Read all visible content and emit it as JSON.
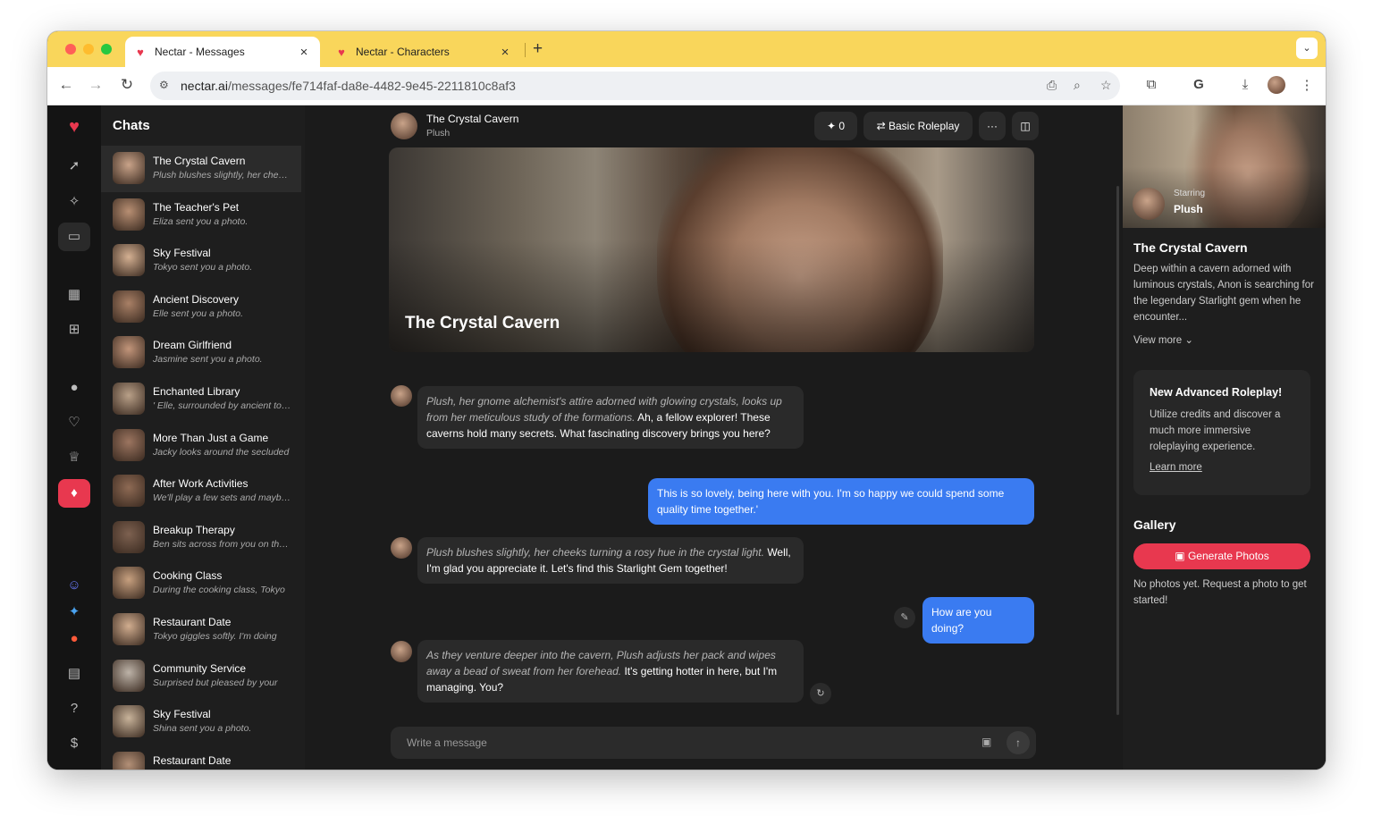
{
  "browser": {
    "tabs": [
      {
        "title": "Nectar - Messages",
        "active": true
      },
      {
        "title": "Nectar - Characters",
        "active": false
      }
    ],
    "url_host": "nectar.ai",
    "url_path": "/messages/fe714faf-da8e-4482-9e45-2211810c8af3"
  },
  "colors": {
    "accent": "#e8384f",
    "user_bubble": "#3a7bf1",
    "tabbar": "#f9d65b"
  },
  "chats": {
    "heading": "Chats",
    "items": [
      {
        "name": "The Crystal Cavern",
        "preview": "Plush blushes slightly, her cheeks turning a rosy hue",
        "active": true
      },
      {
        "name": "The Teacher's Pet",
        "preview": "Eliza sent you a photo."
      },
      {
        "name": "Sky Festival",
        "preview": "Tokyo sent you a photo."
      },
      {
        "name": "Ancient Discovery",
        "preview": "Elle sent you a photo."
      },
      {
        "name": "Dream Girlfriend",
        "preview": "Jasmine sent you a photo."
      },
      {
        "name": "Enchanted Library",
        "preview": "' Elle, surrounded by ancient tomes"
      },
      {
        "name": "More Than Just a Game",
        "preview": "Jacky looks around the secluded"
      },
      {
        "name": "After Work Activities",
        "preview": "We'll play a few sets and maybe grab"
      },
      {
        "name": "Breakup Therapy",
        "preview": "Ben sits across from you on the couch"
      },
      {
        "name": "Cooking Class",
        "preview": "During the cooking class, Tokyo"
      },
      {
        "name": "Restaurant Date",
        "preview": "Tokyo giggles softly. I'm doing"
      },
      {
        "name": "Community Service",
        "preview": "Surprised but pleased by your"
      },
      {
        "name": "Sky Festival",
        "preview": "Shina sent you a photo."
      },
      {
        "name": "Restaurant Date",
        "preview": ""
      }
    ]
  },
  "conversation": {
    "title": "The Crystal Cavern",
    "character": "Plush",
    "count": "0",
    "mode": "Basic Roleplay",
    "hero_title": "The Crystal Cavern",
    "messages": [
      {
        "from": "bot",
        "action": "Plush, her gnome alchemist's attire adorned with glowing crystals, looks up from her meticulous study of the formations.",
        "text": " Ah, a fellow explorer! These caverns hold many secrets. What fascinating discovery brings you here?"
      },
      {
        "from": "user",
        "text": "This is so lovely, being here with you. I'm so happy we could spend some quality time together.'"
      },
      {
        "from": "bot",
        "action": "Plush blushes slightly, her cheeks turning a rosy hue in the crystal light.",
        "text": " Well, I'm glad you appreciate it. Let's find this Starlight Gem together!"
      },
      {
        "from": "user",
        "text": "How are you doing?"
      },
      {
        "from": "bot",
        "action": "As they venture deeper into the cavern, Plush adjusts her pack and wipes away a bead of sweat from her forehead.",
        "text": " It's getting hotter in here, but I'm managing. You?"
      }
    ],
    "composer_placeholder": "Write a message"
  },
  "scenario": {
    "starring_label": "Starring",
    "starring_name": "Plush",
    "title": "The Crystal Cavern",
    "description": "Deep within a cavern adorned with luminous crystals, Anon is searching for the legendary Starlight gem when he encounter...",
    "view_more": "View more",
    "promo_title": "New Advanced Roleplay!",
    "promo_text": "Utilize credits and discover a much more immersive roleplaying experience.",
    "promo_link": "Learn more",
    "gallery_title": "Gallery",
    "generate_label": "Generate Photos",
    "no_photos": "No photos yet. Request a photo to get started!"
  }
}
